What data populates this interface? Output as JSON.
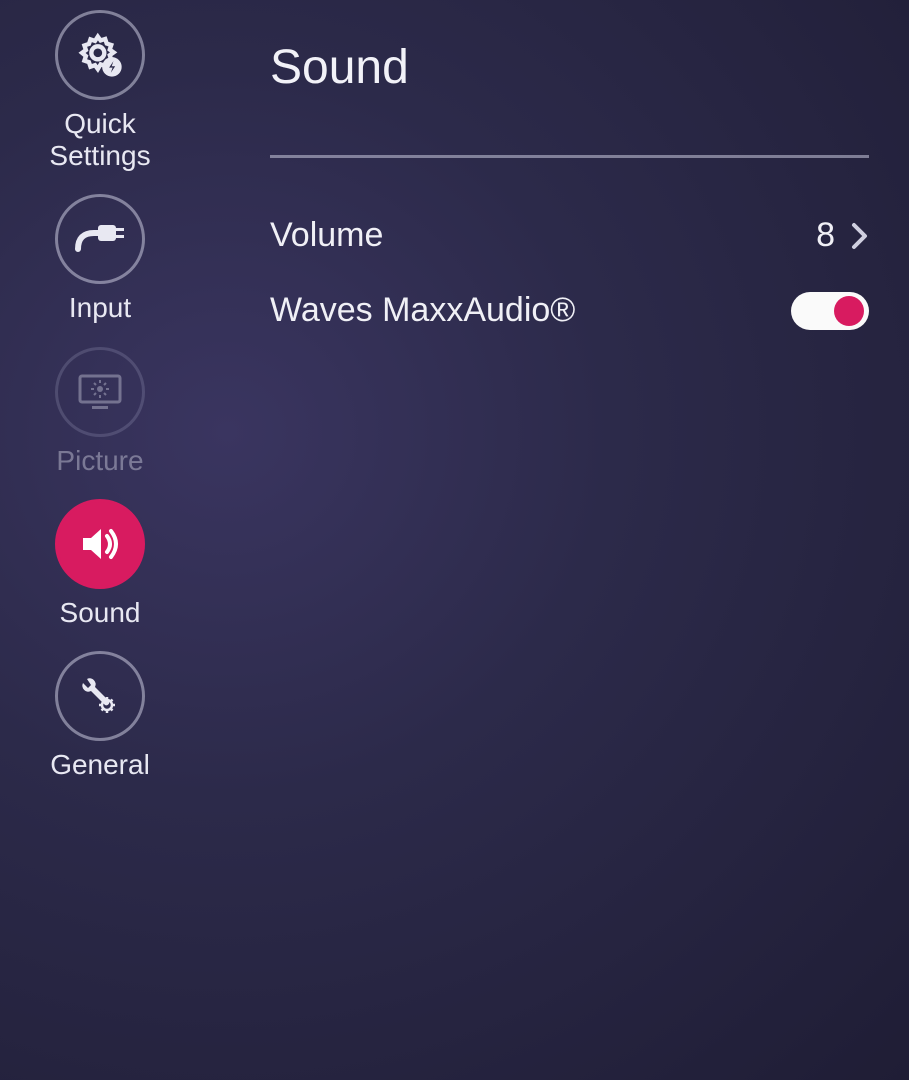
{
  "sidebar": {
    "items": [
      {
        "label": "Quick\nSettings",
        "icon": "gear-bolt-icon",
        "active": false,
        "dim": false
      },
      {
        "label": "Input",
        "icon": "plug-icon",
        "active": false,
        "dim": false
      },
      {
        "label": "Picture",
        "icon": "brightness-monitor-icon",
        "active": false,
        "dim": true
      },
      {
        "label": "Sound",
        "icon": "speaker-icon",
        "active": true,
        "dim": false
      },
      {
        "label": "General",
        "icon": "wrench-gear-icon",
        "active": false,
        "dim": false
      }
    ]
  },
  "main": {
    "title": "Sound",
    "rows": [
      {
        "label": "Volume",
        "value": "8",
        "type": "chevron"
      },
      {
        "label": "Waves  MaxxAudio®",
        "type": "toggle",
        "toggled": true
      }
    ]
  },
  "colors": {
    "accent": "#d81b60"
  }
}
